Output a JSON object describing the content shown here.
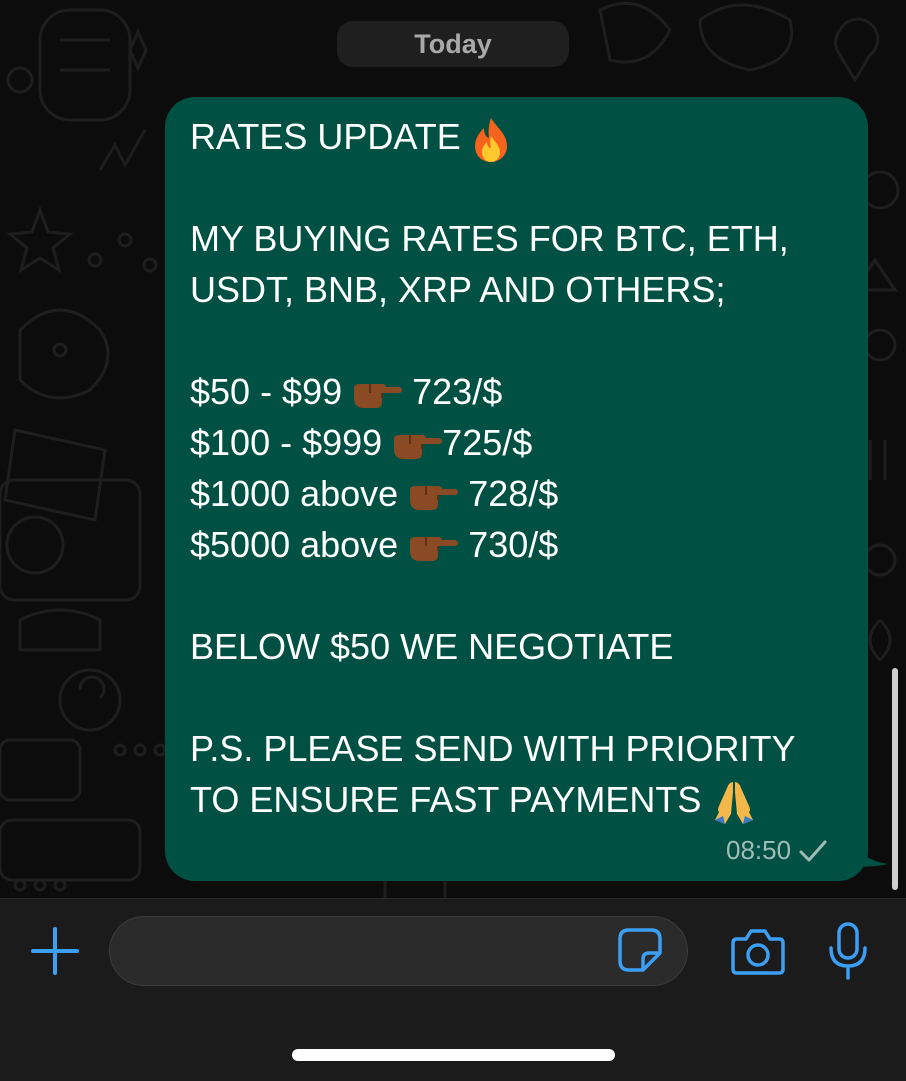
{
  "chat": {
    "date_separator": "Today",
    "message": {
      "lines": [
        {
          "text": "RATES UPDATE ",
          "emoji": "fire"
        },
        {
          "text": ""
        },
        {
          "text": "MY BUYING RATES FOR BTC, ETH,"
        },
        {
          "text": "USDT, BNB, XRP AND OTHERS;"
        },
        {
          "text": ""
        },
        {
          "before": "$50 - $99 ",
          "emoji": "pointing-right",
          "after": " 723/$"
        },
        {
          "before": "$100 - $999 ",
          "emoji": "pointing-right",
          "after": "725/$"
        },
        {
          "before": "$1000 above ",
          "emoji": "pointing-right",
          "after": " 728/$"
        },
        {
          "before": "$5000 above ",
          "emoji": "pointing-right",
          "after": " 730/$"
        },
        {
          "text": ""
        },
        {
          "text": "BELOW $50 WE NEGOTIATE"
        },
        {
          "text": ""
        },
        {
          "text": "P.S. PLEASE SEND WITH PRIORITY"
        },
        {
          "text": "TO ENSURE FAST PAYMENTS ",
          "emoji": "folded-hands"
        }
      ],
      "time": "08:50",
      "status": "sent-check"
    }
  },
  "composer": {
    "input_value": "",
    "icons": {
      "attach": "plus-icon",
      "sticker": "sticker-icon",
      "camera": "camera-icon",
      "voice": "microphone-icon"
    }
  },
  "colors": {
    "outgoing_bubble": "#005143",
    "accent": "#3a9ff5",
    "background": "#0c0c0c",
    "input_bar": "#1b1b1b"
  }
}
